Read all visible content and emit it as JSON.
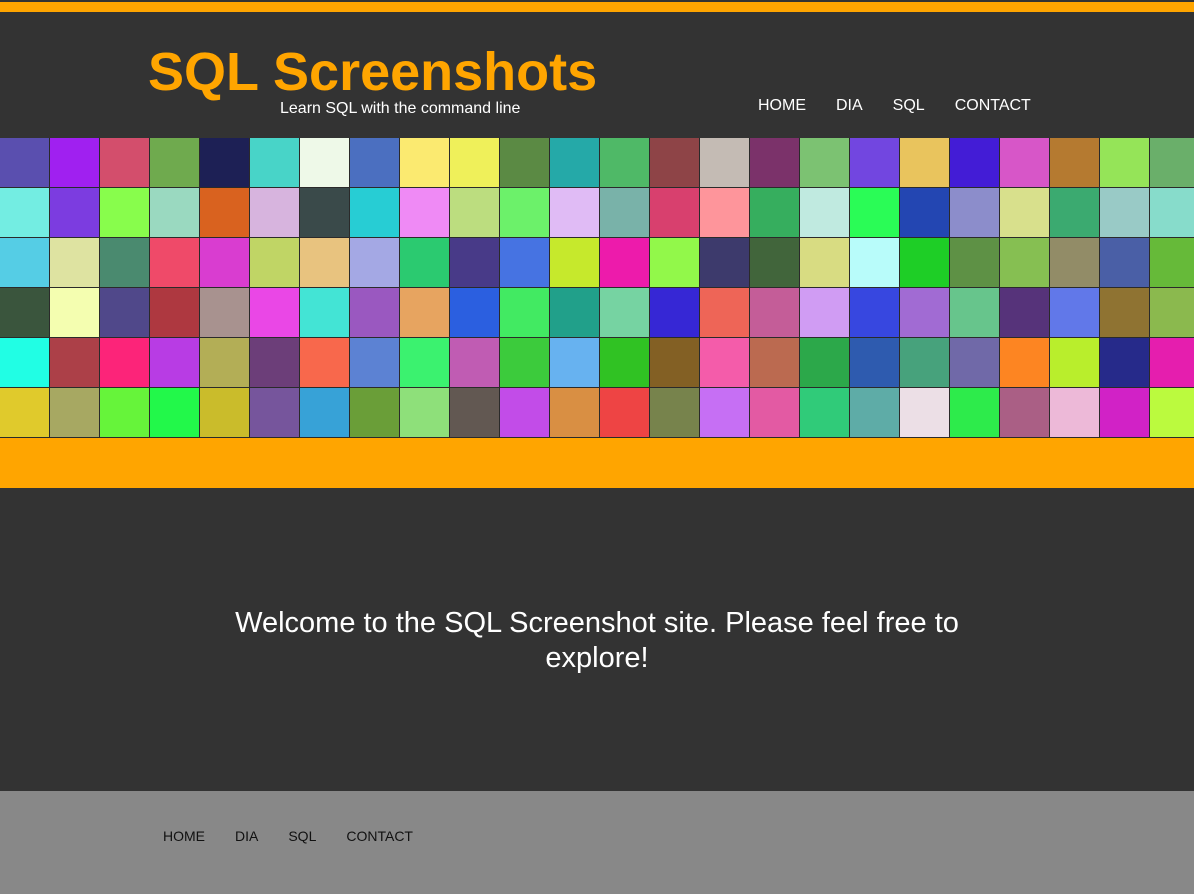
{
  "header": {
    "title": "SQL Screenshots",
    "tagline": "Learn SQL with the command line"
  },
  "nav": [
    "HOME",
    "DIA",
    "SQL",
    "CONTACT"
  ],
  "main": {
    "welcome": "Welcome to the SQL Screenshot site. Please feel free to explore!"
  },
  "footer_nav": [
    "HOME",
    "DIA",
    "SQL",
    "CONTACT"
  ],
  "colors": {
    "accent": "#FFA500",
    "background": "#333333",
    "footer": "#888888"
  },
  "mosaic_colors": [
    [
      "#5A4FAF",
      "#A020F0",
      "#D34E6C",
      "#6FAA4E",
      "#1D2055",
      "#48D4C8",
      "#EEF9E8",
      "#4B6FC0",
      "#FBEA70",
      "#EFF05A",
      "#5B8A44",
      "#25A9A8",
      "#4FB967",
      "#8E4447",
      "#C4BBB4",
      "#7B326A",
      "#7CC272",
      "#7246E0",
      "#E9C45D",
      "#431CD6",
      "#D756C8",
      "#B57A30",
      "#95E458",
      "#6AAF6A"
    ],
    [
      "#73EDE2",
      "#7C3CE0",
      "#88FD4C",
      "#9AD9C0",
      "#D9621F",
      "#D7B4DE",
      "#3A4A4A",
      "#27CDD4",
      "#EF8AF5",
      "#BCDD7F",
      "#6CF16A",
      "#E0BBF5",
      "#79B2A9",
      "#D8406E",
      "#FE959B",
      "#36AE5E",
      "#C0EAE0",
      "#2AFC56",
      "#2346B2",
      "#8C8DCB",
      "#D8E08C",
      "#3BAA70",
      "#99CAC6",
      "#87DCCB"
    ],
    [
      "#55CDE5",
      "#DEE3A1",
      "#4A8A6F",
      "#EF4A69",
      "#D93DD0",
      "#C0D565",
      "#E8C37F",
      "#A4A8E4",
      "#2BCA70",
      "#483A88",
      "#4673E2",
      "#C6E92C",
      "#ED1BAB",
      "#92F84A",
      "#3D3A6C",
      "#41653B",
      "#D8DC82",
      "#B8FCFA",
      "#1ECE26",
      "#5E9145",
      "#86BF52",
      "#928C67",
      "#4A5FA6",
      "#66BA39"
    ],
    [
      "#3A553D",
      "#F4FEB0",
      "#50488A",
      "#AE3840",
      "#A8928F",
      "#EA47E6",
      "#43E4D5",
      "#9A58C0",
      "#E7A460",
      "#2B5FE0",
      "#42EA62",
      "#21A08A",
      "#76D3A2",
      "#3627D5",
      "#EE6557",
      "#C45D98",
      "#D09CF3",
      "#3747E0",
      "#A16BD3",
      "#67C58C",
      "#56337A",
      "#6178E9",
      "#8F7332",
      "#8BB94E"
    ],
    [
      "#21FEE4",
      "#AC4048",
      "#FC2479",
      "#B83CE4",
      "#B3AE56",
      "#6C3E79",
      "#F8684C",
      "#5C82D3",
      "#3BF26F",
      "#C05CB3",
      "#3CCB3C",
      "#67B2F0",
      "#30C223",
      "#836024",
      "#F45CAA",
      "#BB6A50",
      "#2CA84A",
      "#2E5BAF",
      "#47A27C",
      "#7069A8",
      "#FD8522",
      "#B9EE2C",
      "#262A8A",
      "#E51EAE"
    ],
    [
      "#E0CA2C",
      "#A7A862",
      "#66F43A",
      "#22F84A",
      "#CABC2B",
      "#76559C",
      "#37A2D7",
      "#6A9E38",
      "#8EE07A",
      "#625852",
      "#C24CE8",
      "#D98F43",
      "#EE4444",
      "#77834C",
      "#C66FF4",
      "#E35AA3",
      "#30CB79",
      "#5EACA7",
      "#ECDFE6",
      "#2DEB4B",
      "#AA5F85",
      "#EDB9D8",
      "#D122C6",
      "#BBFA3E"
    ]
  ]
}
